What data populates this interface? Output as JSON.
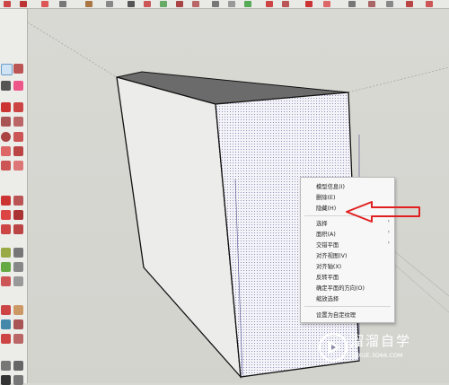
{
  "context_menu": {
    "items": [
      {
        "label": "模型信息(I)",
        "submenu": false
      },
      {
        "label": "删除(E)",
        "submenu": false
      },
      {
        "label": "隐藏(H)",
        "submenu": false
      },
      {
        "label": "选择",
        "submenu": true
      },
      {
        "label": "面积(A)",
        "submenu": true
      },
      {
        "label": "交错平面",
        "submenu": true
      },
      {
        "label": "对齐视图(V)",
        "submenu": false
      },
      {
        "label": "对齐轴(X)",
        "submenu": false
      },
      {
        "label": "反转平面",
        "submenu": false
      },
      {
        "label": "确定平面的方向(O)",
        "submenu": false
      },
      {
        "label": "缩放选择",
        "submenu": false
      },
      {
        "label": "设置为自定纹理",
        "submenu": false
      }
    ],
    "submenu_glyph": "›"
  },
  "watermark": {
    "text": "溜溜自学",
    "url": "ZIXUE.3D66.COM",
    "icon": "play-logo"
  },
  "colors": {
    "annotation_arrow": "#e02020",
    "watermark": "#ffffff"
  }
}
